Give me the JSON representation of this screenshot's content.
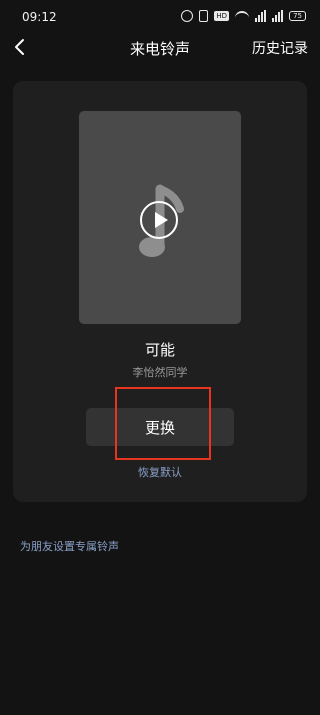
{
  "status_bar": {
    "time": "09:12",
    "hd_label": "HD",
    "battery_level": "75"
  },
  "header": {
    "title": "来电铃声",
    "history_label": "历史记录"
  },
  "ringtone": {
    "song_title": "可能",
    "artist": "李怡然同学",
    "change_label": "更换",
    "restore_label": "恢复默认"
  },
  "friend_link_label": "为朋友设置专属铃声",
  "colors": {
    "background": "#131313",
    "card": "#1f1f1f",
    "cover": "#4a4a4a",
    "link": "#8aa0c8",
    "highlight": "#e8351f"
  },
  "icons": {
    "back": "chevron-left-icon",
    "play": "play-icon",
    "note": "music-note-icon"
  }
}
